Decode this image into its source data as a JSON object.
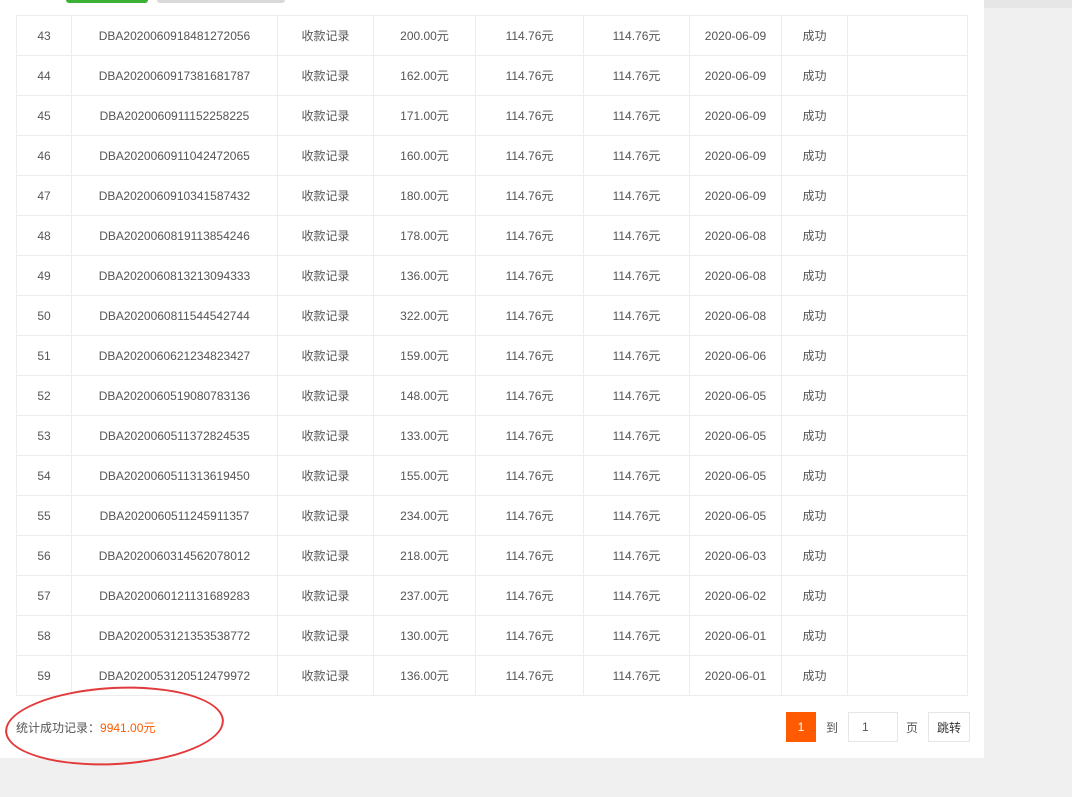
{
  "table": {
    "rows": [
      {
        "no": "43",
        "order": "DBA2020060918481272056",
        "type": "收款记录",
        "amount": "200.00元",
        "fee1": "114.76元",
        "fee2": "114.76元",
        "date": "2020-06-09",
        "status": "成功"
      },
      {
        "no": "44",
        "order": "DBA2020060917381681787",
        "type": "收款记录",
        "amount": "162.00元",
        "fee1": "114.76元",
        "fee2": "114.76元",
        "date": "2020-06-09",
        "status": "成功"
      },
      {
        "no": "45",
        "order": "DBA2020060911152258225",
        "type": "收款记录",
        "amount": "171.00元",
        "fee1": "114.76元",
        "fee2": "114.76元",
        "date": "2020-06-09",
        "status": "成功"
      },
      {
        "no": "46",
        "order": "DBA2020060911042472065",
        "type": "收款记录",
        "amount": "160.00元",
        "fee1": "114.76元",
        "fee2": "114.76元",
        "date": "2020-06-09",
        "status": "成功"
      },
      {
        "no": "47",
        "order": "DBA2020060910341587432",
        "type": "收款记录",
        "amount": "180.00元",
        "fee1": "114.76元",
        "fee2": "114.76元",
        "date": "2020-06-09",
        "status": "成功"
      },
      {
        "no": "48",
        "order": "DBA2020060819113854246",
        "type": "收款记录",
        "amount": "178.00元",
        "fee1": "114.76元",
        "fee2": "114.76元",
        "date": "2020-06-08",
        "status": "成功"
      },
      {
        "no": "49",
        "order": "DBA2020060813213094333",
        "type": "收款记录",
        "amount": "136.00元",
        "fee1": "114.76元",
        "fee2": "114.76元",
        "date": "2020-06-08",
        "status": "成功"
      },
      {
        "no": "50",
        "order": "DBA2020060811544542744",
        "type": "收款记录",
        "amount": "322.00元",
        "fee1": "114.76元",
        "fee2": "114.76元",
        "date": "2020-06-08",
        "status": "成功"
      },
      {
        "no": "51",
        "order": "DBA2020060621234823427",
        "type": "收款记录",
        "amount": "159.00元",
        "fee1": "114.76元",
        "fee2": "114.76元",
        "date": "2020-06-06",
        "status": "成功"
      },
      {
        "no": "52",
        "order": "DBA2020060519080783136",
        "type": "收款记录",
        "amount": "148.00元",
        "fee1": "114.76元",
        "fee2": "114.76元",
        "date": "2020-06-05",
        "status": "成功"
      },
      {
        "no": "53",
        "order": "DBA2020060511372824535",
        "type": "收款记录",
        "amount": "133.00元",
        "fee1": "114.76元",
        "fee2": "114.76元",
        "date": "2020-06-05",
        "status": "成功"
      },
      {
        "no": "54",
        "order": "DBA2020060511313619450",
        "type": "收款记录",
        "amount": "155.00元",
        "fee1": "114.76元",
        "fee2": "114.76元",
        "date": "2020-06-05",
        "status": "成功"
      },
      {
        "no": "55",
        "order": "DBA2020060511245911357",
        "type": "收款记录",
        "amount": "234.00元",
        "fee1": "114.76元",
        "fee2": "114.76元",
        "date": "2020-06-05",
        "status": "成功"
      },
      {
        "no": "56",
        "order": "DBA2020060314562078012",
        "type": "收款记录",
        "amount": "218.00元",
        "fee1": "114.76元",
        "fee2": "114.76元",
        "date": "2020-06-03",
        "status": "成功"
      },
      {
        "no": "57",
        "order": "DBA2020060121131689283",
        "type": "收款记录",
        "amount": "237.00元",
        "fee1": "114.76元",
        "fee2": "114.76元",
        "date": "2020-06-02",
        "status": "成功"
      },
      {
        "no": "58",
        "order": "DBA2020053121353538772",
        "type": "收款记录",
        "amount": "130.00元",
        "fee1": "114.76元",
        "fee2": "114.76元",
        "date": "2020-06-01",
        "status": "成功"
      },
      {
        "no": "59",
        "order": "DBA2020053120512479972",
        "type": "收款记录",
        "amount": "136.00元",
        "fee1": "114.76元",
        "fee2": "114.76元",
        "date": "2020-06-01",
        "status": "成功"
      }
    ]
  },
  "footer": {
    "total_label": "统计成功记录：",
    "total_amount": "9941.00元"
  },
  "pagination": {
    "current_page": "1",
    "to_label": "到",
    "page_input_value": "1",
    "page_label": "页",
    "jump_label": "跳转"
  },
  "colors": {
    "accent": "#ff5a00",
    "annotation": "#e23a3a",
    "tab_active": "#3cb034"
  }
}
